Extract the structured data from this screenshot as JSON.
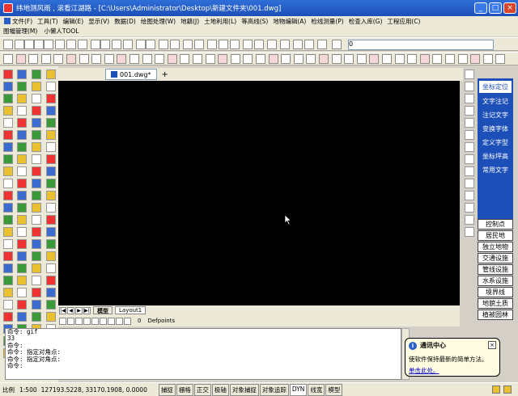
{
  "titlebar": {
    "title": "纬地测风雨 , 滚看江湖路 - [C:\\Users\\Administrator\\Desktop\\新建文件夹\\001.dwg]",
    "minimize": "_",
    "maximize": "□",
    "close": "×"
  },
  "menu": [
    "文件(F)",
    "工具(T)",
    "编辑(E)",
    "显示(V)",
    "数据(D)",
    "绘图处理(W)",
    "地籍(J)",
    "土地利用(L)",
    "等高线(S)",
    "地物编辑(A)",
    "检线测量(P)",
    "检查入库(G)",
    "工程应用(C)"
  ],
  "menu2": [
    "图幅管理(M)",
    "小懒人TOOL"
  ],
  "toolbar": {
    "layer_dropdown": "0"
  },
  "document": {
    "tab": "001.dwg*",
    "new_tab": "+"
  },
  "layouts": {
    "nav": [
      "|◀",
      "◀",
      "▶",
      "▶|"
    ],
    "tabs": [
      "模型",
      "Layout1"
    ]
  },
  "layerbar": {
    "layer": "0",
    "current": "Defpoints"
  },
  "right_panel": {
    "buttons": [
      "坐标定位",
      "文字注记",
      "注记文字",
      "变换字体",
      "定义字型",
      "坐标坪高",
      "常用文字"
    ],
    "selected": 0
  },
  "right_panel2": [
    "控制点",
    "居民地",
    "独立地物",
    "交通设施",
    "管线设施",
    "水系设施",
    "境界线",
    "地貌土质",
    "植被园林"
  ],
  "command_lines": [
    "命令: gif",
    "33",
    "命令:",
    "命令: 指定对角点:",
    "命令: 指定对角点:",
    "命令:"
  ],
  "notification": {
    "title": "通讯中心",
    "info": "i",
    "close": "×",
    "message": "使软件保持最新的简单方法。",
    "link": "单击此处。"
  },
  "status": {
    "scale": "比例",
    "scale_value": "1:500",
    "coords": "127193.5228, 33170.1908, 0.0000",
    "buttons": [
      "捕捉",
      "栅格",
      "正交",
      "极轴",
      "对象捕捉",
      "对象追踪",
      "DYN",
      "线宽",
      "模型"
    ],
    "active": [
      6
    ]
  },
  "colors": {
    "title": "#1c4fb8",
    "canvas": "#000000",
    "panel": "#1c4fb8"
  }
}
